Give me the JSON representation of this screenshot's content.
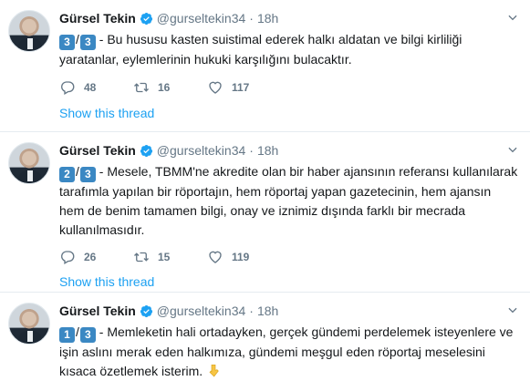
{
  "tweets": [
    {
      "author_name": "Gürsel Tekin",
      "handle": "@gurseltekin34",
      "separator": "·",
      "time": "18h",
      "thread_index": "3",
      "thread_total": "3",
      "thread_slash": "/",
      "text": " - Bu hususu kasten suistimal ederek halkı aldatan ve bilgi kirliliği yaratanlar,  eylemlerinin hukuki karşılığını bulacaktır.",
      "replies": "48",
      "retweets": "16",
      "likes": "117",
      "show_thread": "Show this thread"
    },
    {
      "author_name": "Gürsel Tekin",
      "handle": "@gurseltekin34",
      "separator": "·",
      "time": "18h",
      "thread_index": "2",
      "thread_total": "3",
      "thread_slash": "/",
      "text": " - Mesele, TBMM'ne akredite olan bir haber ajansının referansı kullanılarak tarafımla yapılan bir röportajın, hem röportaj yapan gazetecinin, hem ajansın hem de benim tamamen bilgi, onay ve iznimiz dışında farklı bir mecrada kullanılmasıdır.",
      "replies": "26",
      "retweets": "15",
      "likes": "119",
      "show_thread": "Show this thread"
    },
    {
      "author_name": "Gürsel Tekin",
      "handle": "@gurseltekin34",
      "separator": "·",
      "time": "18h",
      "thread_index": "1",
      "thread_total": "3",
      "thread_slash": "/",
      "text": " - Memleketin hali ortadayken, gerçek gündemi perdelemek isteyenlere ve işin aslını merak eden halkımıza, gündemi meşgul eden röportaj meselesini kısaca özetlemek isterim.",
      "emoji": "pointing-down-hand-icon"
    }
  ],
  "colors": {
    "link": "#1da1f2",
    "muted": "#657786",
    "keycap": "#3b88c3",
    "divider": "#e6ecf0"
  }
}
